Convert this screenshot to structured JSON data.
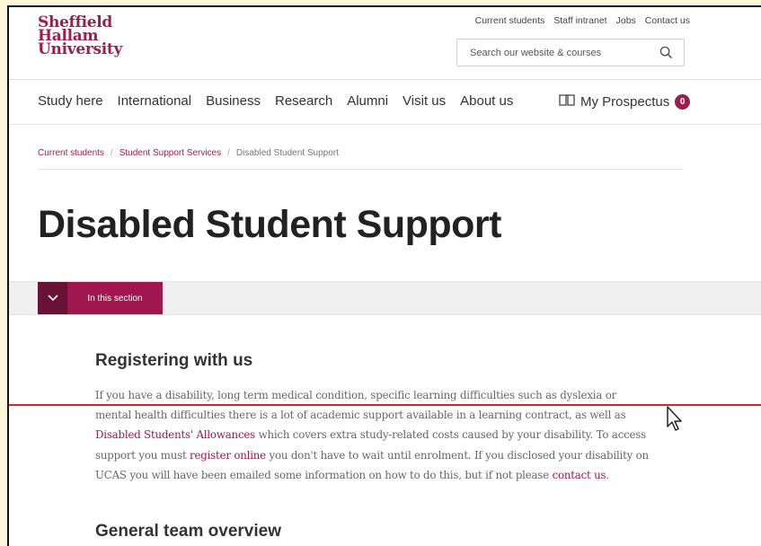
{
  "logo": {
    "line1": "Sheffield",
    "line2": "Hallam",
    "line3": "University"
  },
  "utility_links": [
    "Current students",
    "Staff intranet",
    "Jobs",
    "Contact us"
  ],
  "search": {
    "placeholder": "Search our website & courses"
  },
  "nav": [
    "Study here",
    "International",
    "Business",
    "Research",
    "Alumni",
    "Visit us",
    "About us"
  ],
  "prospectus": {
    "label": "My Prospectus",
    "count": "0"
  },
  "breadcrumb": [
    "Current students",
    "Student Support Services",
    "Disabled Student Support"
  ],
  "page_title": "Disabled Student Support",
  "section_toggle": {
    "label": "In this section"
  },
  "content": {
    "heading1": "Registering with us",
    "p1": {
      "t1": "If you have a disability, long term medical condition, specific learning difficulties such as dyslexia or mental health difficulties there is a lot of academic support available in a learning contract, as well as ",
      "link1": "Disabled Students' Allowances",
      "t2": " which covers extra study-related costs caused by your disability. To access support you must ",
      "link2": "register online",
      "t3": " you don't have to wait until enrolment. If you disclosed your disability on UCAS you will have been emailed some information on how to do this, but if not please ",
      "link3": "contact us",
      "t4": "."
    },
    "heading2": "General team overview"
  },
  "colors": {
    "brand": "#9b1f4d",
    "brand_dark": "#6a1235",
    "highlight_line": "#d42a2a"
  }
}
